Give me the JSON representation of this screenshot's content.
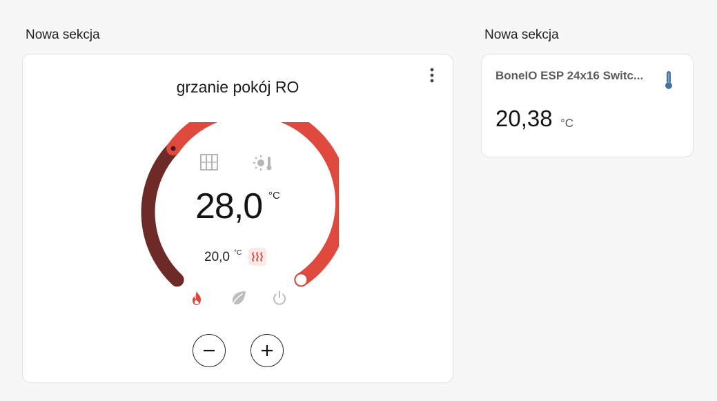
{
  "sections": [
    {
      "title": "Nowa sekcja"
    },
    {
      "title": "Nowa sekcja"
    }
  ],
  "thermostat": {
    "name": "grzanie pokój RO",
    "target_temperature": "28,0",
    "target_unit": "°C",
    "current_temperature": "20,0",
    "current_unit": "°C",
    "action": "heating",
    "modes": [
      "heat",
      "eco",
      "off"
    ],
    "active_mode": "heat",
    "features": [
      "window-icon",
      "sun-thermometer-icon"
    ],
    "colors": {
      "accent": "#db4437",
      "accent_dark": "#6e2a26",
      "inactive": "#bdbdbd"
    }
  },
  "sensor": {
    "name": "BoneIO ESP 24x16 Switc...",
    "value": "20,38",
    "unit": "°C",
    "icon": "thermometer-icon",
    "icon_color": "#44739e"
  }
}
